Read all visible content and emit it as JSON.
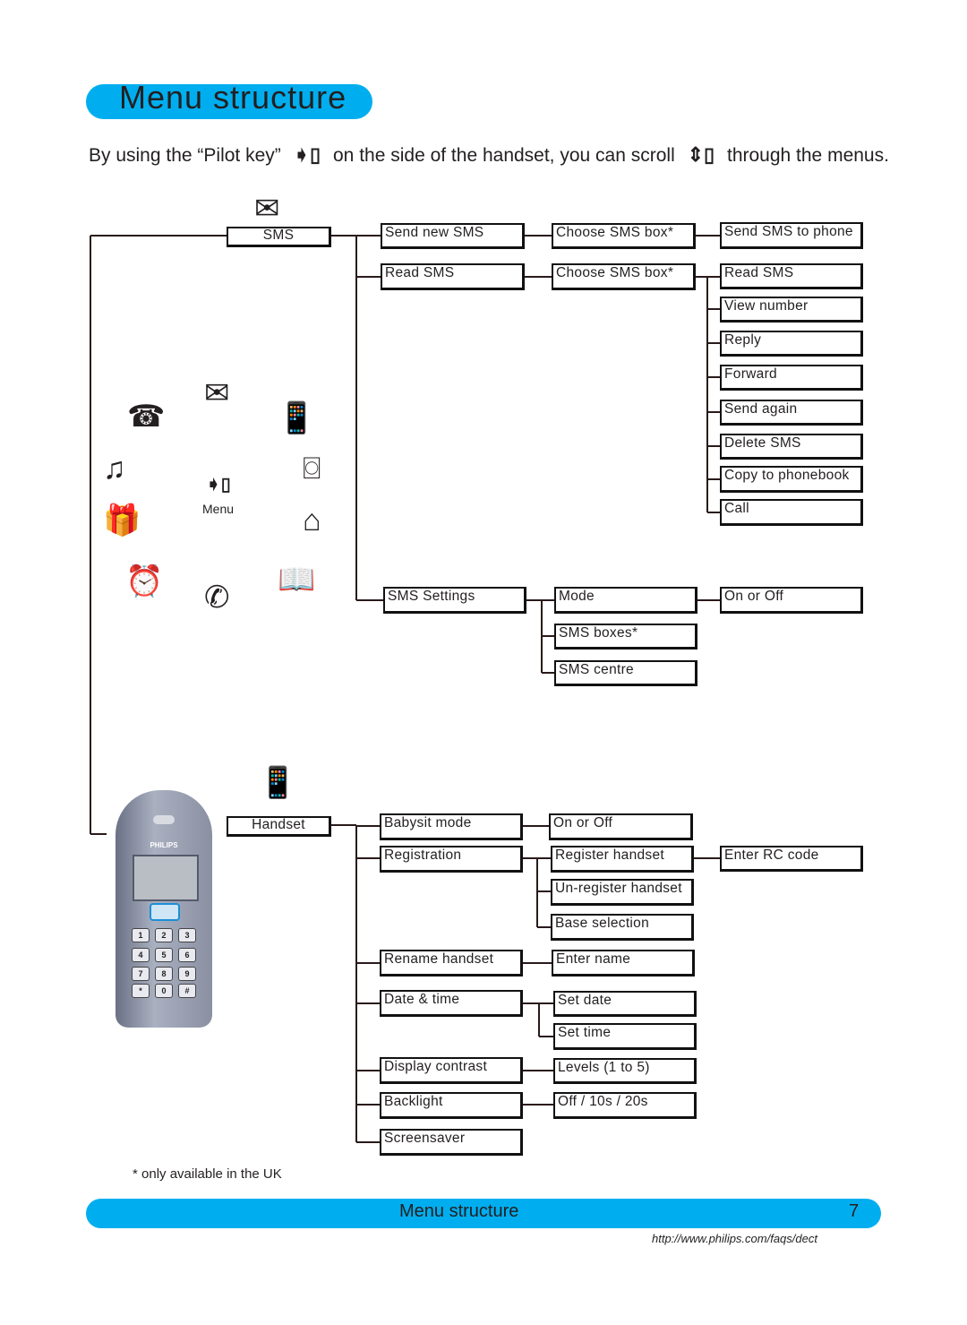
{
  "header": {
    "title": "Menu structure",
    "intro_before": "By using the “Pilot key”",
    "intro_middle": "on the side of the handset, you can scroll",
    "intro_after": "through the menus."
  },
  "colors": {
    "accent": "#00aeef"
  },
  "sms_branch": {
    "root": "SMS",
    "level1": [
      "Send new SMS",
      "Read SMS",
      "SMS Settings"
    ],
    "send_new": {
      "choose": "Choose SMS box*",
      "action": "Send SMS to phone"
    },
    "read": {
      "choose": "Choose SMS box*",
      "options": [
        "Read SMS",
        "View number",
        "Reply",
        "Forward",
        "Send again",
        "Delete SMS",
        "Copy to phonebook",
        "Call"
      ]
    },
    "settings": {
      "options": [
        "Mode",
        "SMS boxes*",
        "SMS centre"
      ],
      "mode_value": "On or Off"
    }
  },
  "menu_wheel": {
    "label": "Menu",
    "icons": [
      "envelope-icon",
      "handset-settings-icon",
      "answering-machine-icon",
      "base-phone-icon",
      "phonebook-icon",
      "call-log-icon",
      "alarm-icon",
      "gift-icon",
      "music-icon",
      "base-settings-icon"
    ]
  },
  "handset_branch": {
    "root": "Handset",
    "level1": [
      "Babysit mode",
      "Registration",
      "Rename handset",
      "Date & time",
      "Display contrast",
      "Backlight",
      "Screensaver"
    ],
    "babysit": "On or Off",
    "registration": [
      "Register handset",
      "Un-register handset",
      "Base selection"
    ],
    "register_next": "Enter RC code",
    "rename": "Enter name",
    "date_time": [
      "Set date",
      "Set time"
    ],
    "contrast": "Levels (1 to 5)",
    "backlight": "Off / 10s / 20s"
  },
  "phone": {
    "brand": "PHILIPS"
  },
  "footnote": "* only available in the UK",
  "footer": {
    "title": "Menu structure",
    "page": "7",
    "url": "http://www.philips.com/faqs/dect"
  }
}
